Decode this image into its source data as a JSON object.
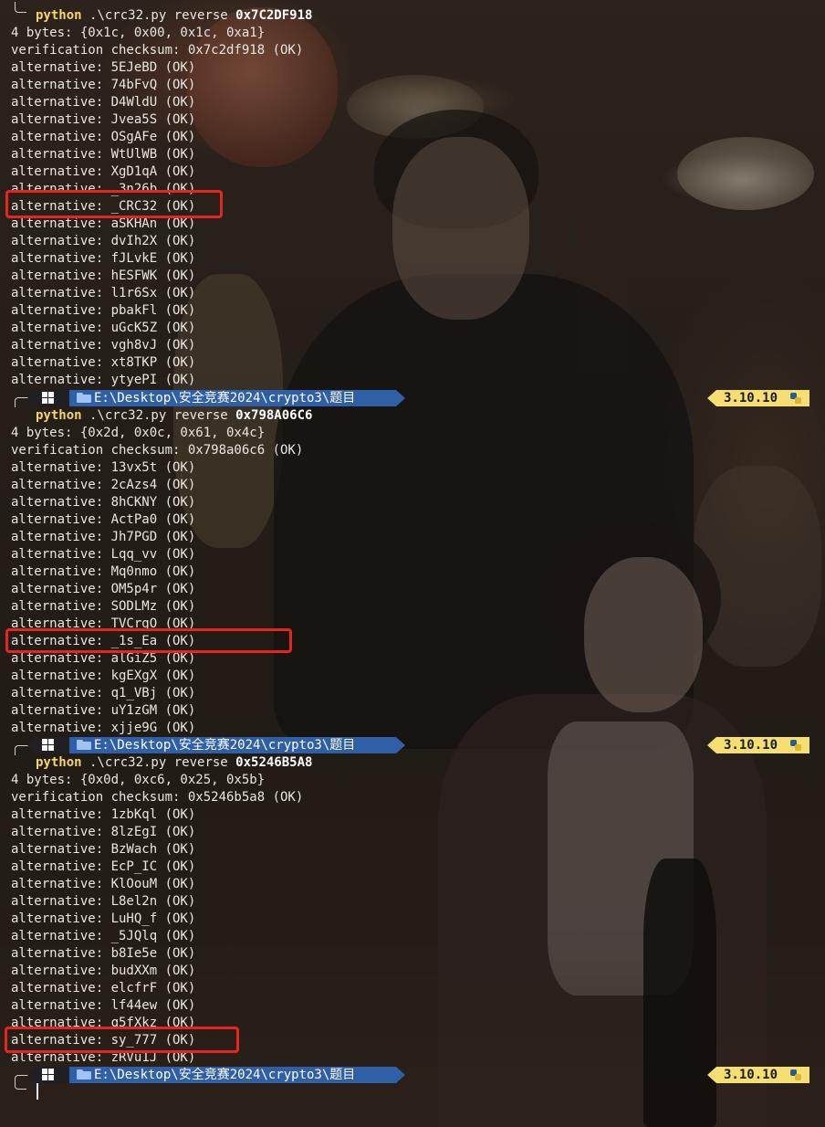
{
  "prompt": {
    "os_icon": "windows-icon",
    "folder_icon": "folder-icon",
    "path": "E:\\Desktop\\安全竞赛2024\\crypto3\\题目",
    "python_version": "3.10.10",
    "python_icon": "python-icon",
    "colors": {
      "path_bg": "#2f5fa6",
      "version_bg": "#f5df72",
      "highlight": "#e8241f"
    }
  },
  "blocks": [
    {
      "command": {
        "program": "python",
        "args": " .\\crc32.py reverse ",
        "hex": "0x7C2DF918"
      },
      "bytes": "4 bytes: {0x1c, 0x00, 0x1c, 0xa1}",
      "verification": "verification checksum: 0x7c2df918 (OK)",
      "alternatives": [
        "alternative: 5EJeBD (OK)",
        "alternative: 74bFvQ (OK)",
        "alternative: D4WldU (OK)",
        "alternative: Jvea5S (OK)",
        "alternative: OSgAFe (OK)",
        "alternative: WtUlWB (OK)",
        "alternative: XgD1qA (OK)",
        "alternative: _3n26b (OK)",
        "alternative: _CRC32 (OK)",
        "alternative: aSKHAn (OK)",
        "alternative: dvIh2X (OK)",
        "alternative: fJLvkE (OK)",
        "alternative: hESFWK (OK)",
        "alternative: l1r6Sx (OK)",
        "alternative: pbakFl (OK)",
        "alternative: uGcK5Z (OK)",
        "alternative: vgh8vJ (OK)",
        "alternative: xt8TKP (OK)",
        "alternative: ytyePI (OK)"
      ]
    },
    {
      "command": {
        "program": "python",
        "args": " .\\crc32.py reverse ",
        "hex": "0x798A06C6"
      },
      "bytes": "4 bytes: {0x2d, 0x0c, 0x61, 0x4c}",
      "verification": "verification checksum: 0x798a06c6 (OK)",
      "alternatives": [
        "alternative: 13vx5t (OK)",
        "alternative: 2cAzs4 (OK)",
        "alternative: 8hCKNY (OK)",
        "alternative: ActPa0 (OK)",
        "alternative: Jh7PGD (OK)",
        "alternative: Lqq_vv (OK)",
        "alternative: Mq0nmo (OK)",
        "alternative: OM5p4r (OK)",
        "alternative: SODLMz (OK)",
        "alternative: TVCrgO (OK)",
        "alternative: _1s_Ea (OK)",
        "alternative: alGiZ5 (OK)",
        "alternative: kgEXgX (OK)",
        "alternative: q1_VBj (OK)",
        "alternative: uY1zGM (OK)",
        "alternative: xjje9G (OK)"
      ]
    },
    {
      "command": {
        "program": "python",
        "args": " .\\crc32.py reverse ",
        "hex": "0x5246B5A8"
      },
      "bytes": "4 bytes: {0x0d, 0xc6, 0x25, 0x5b}",
      "verification": "verification checksum: 0x5246b5a8 (OK)",
      "alternatives": [
        "alternative: 1zbKql (OK)",
        "alternative: 8lzEgI (OK)",
        "alternative: BzWach (OK)",
        "alternative: EcP_IC (OK)",
        "alternative: KlOouM (OK)",
        "alternative: L8el2n (OK)",
        "alternative: LuHQ_f (OK)",
        "alternative: _5JQlq (OK)",
        "alternative: b8Ie5e (OK)",
        "alternative: budXXm (OK)",
        "alternative: elcfrF (OK)",
        "alternative: lf44ew (OK)",
        "alternative: q5fXkz (OK)",
        "alternative: sy_777 (OK)",
        "alternative: zRVu1J (OK)"
      ]
    }
  ]
}
